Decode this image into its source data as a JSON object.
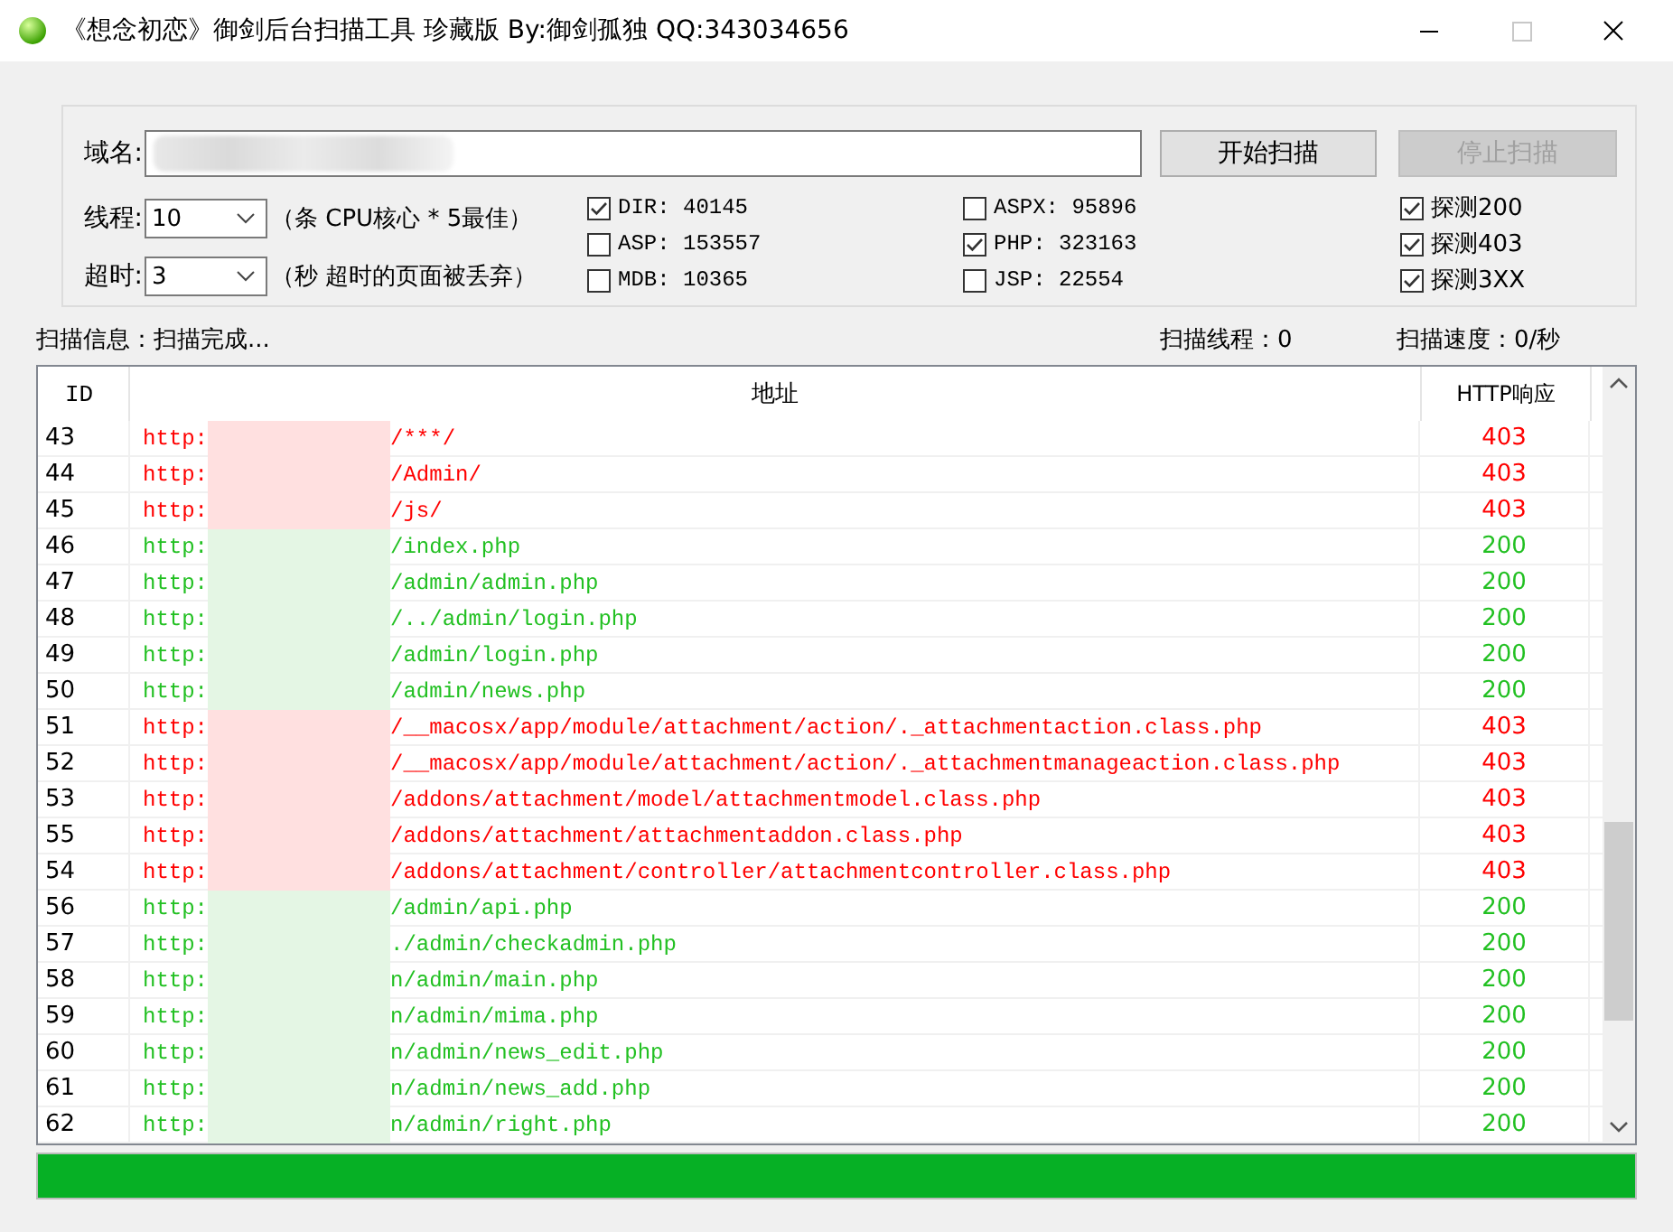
{
  "window": {
    "title": "《想念初恋》御剑后台扫描工具 珍藏版 By:御剑孤独 QQ:343034656"
  },
  "domain": {
    "label": "域名:"
  },
  "buttons": [
    {
      "label": "开始扫描",
      "disabled": false
    },
    {
      "label": "停止扫描",
      "disabled": true
    }
  ],
  "threads": {
    "label": "线程:",
    "value": "10",
    "hint": "（条 CPU核心 * 5最佳）"
  },
  "timeout": {
    "label": "超时:",
    "value": "3",
    "hint": "（秒 超时的页面被丢弃）"
  },
  "option_groups": [
    {
      "items": [
        {
          "label": "DIR: 40145",
          "checked": true
        },
        {
          "label": "ASP: 153557",
          "checked": false
        },
        {
          "label": "MDB: 10365",
          "checked": false
        }
      ]
    },
    {
      "items": [
        {
          "label": "ASPX: 95896",
          "checked": false
        },
        {
          "label": "PHP: 323163",
          "checked": true
        },
        {
          "label": "JSP: 22554",
          "checked": false
        }
      ]
    },
    {
      "items": [
        {
          "label": "探测200",
          "checked": true
        },
        {
          "label": "探测403",
          "checked": true
        },
        {
          "label": "探测3XX",
          "checked": true
        }
      ]
    }
  ],
  "status": {
    "info": "扫描信息：扫描完成...",
    "threads": "扫描线程：0",
    "speed": "扫描速度：0/秒"
  },
  "table": {
    "columns": [
      "ID",
      "地址",
      "HTTP响应"
    ],
    "rows": [
      {
        "id": "43",
        "url_start": "http:",
        "url_end": "/***/",
        "code": "403",
        "color": "#ff0000"
      },
      {
        "id": "44",
        "url_start": "http:",
        "url_end": "/Admin/",
        "code": "403",
        "color": "#ff0000"
      },
      {
        "id": "45",
        "url_start": "http:",
        "url_end": "/js/",
        "code": "403",
        "color": "#ff0000"
      },
      {
        "id": "46",
        "url_start": "http:",
        "url_end": "/index.php",
        "code": "200",
        "color": "#22c022"
      },
      {
        "id": "47",
        "url_start": "http:",
        "url_end": "/admin/admin.php",
        "code": "200",
        "color": "#22c022"
      },
      {
        "id": "48",
        "url_start": "http:",
        "url_end": "/../admin/login.php",
        "code": "200",
        "color": "#22c022"
      },
      {
        "id": "49",
        "url_start": "http:",
        "url_end": "/admin/login.php",
        "code": "200",
        "color": "#22c022"
      },
      {
        "id": "50",
        "url_start": "http:",
        "url_end": "/admin/news.php",
        "code": "200",
        "color": "#22c022"
      },
      {
        "id": "51",
        "url_start": "http:",
        "url_end": "/__macosx/app/module/attachment/action/._attachmentaction.class.php",
        "code": "403",
        "color": "#ff0000"
      },
      {
        "id": "52",
        "url_start": "http:",
        "url_end": "/__macosx/app/module/attachment/action/._attachmentmanageaction.class.php",
        "code": "403",
        "color": "#ff0000"
      },
      {
        "id": "53",
        "url_start": "http:",
        "url_end": "/addons/attachment/model/attachmentmodel.class.php",
        "code": "403",
        "color": "#ff0000"
      },
      {
        "id": "55",
        "url_start": "http:",
        "url_end": "/addons/attachment/attachmentaddon.class.php",
        "code": "403",
        "color": "#ff0000"
      },
      {
        "id": "54",
        "url_start": "http:",
        "url_end": "/addons/attachment/controller/attachmentcontroller.class.php",
        "code": "403",
        "color": "#ff0000"
      },
      {
        "id": "56",
        "url_start": "http:",
        "url_end": "/admin/api.php",
        "code": "200",
        "color": "#22c022"
      },
      {
        "id": "57",
        "url_start": "http:",
        "url_end": "./admin/checkadmin.php",
        "code": "200",
        "color": "#22c022"
      },
      {
        "id": "58",
        "url_start": "http:",
        "url_end": "n/admin/main.php",
        "code": "200",
        "color": "#22c022"
      },
      {
        "id": "59",
        "url_start": "http:",
        "url_end": "n/admin/mima.php",
        "code": "200",
        "color": "#22c022"
      },
      {
        "id": "60",
        "url_start": "http:",
        "url_end": "n/admin/news_edit.php",
        "code": "200",
        "color": "#22c022"
      },
      {
        "id": "61",
        "url_start": "http:",
        "url_end": "n/admin/news_add.php",
        "code": "200",
        "color": "#22c022"
      },
      {
        "id": "62",
        "url_start": "http:",
        "url_end": "n/admin/right.php",
        "code": "200",
        "color": "#22c022"
      }
    ]
  },
  "progress": {
    "level": 1
  }
}
